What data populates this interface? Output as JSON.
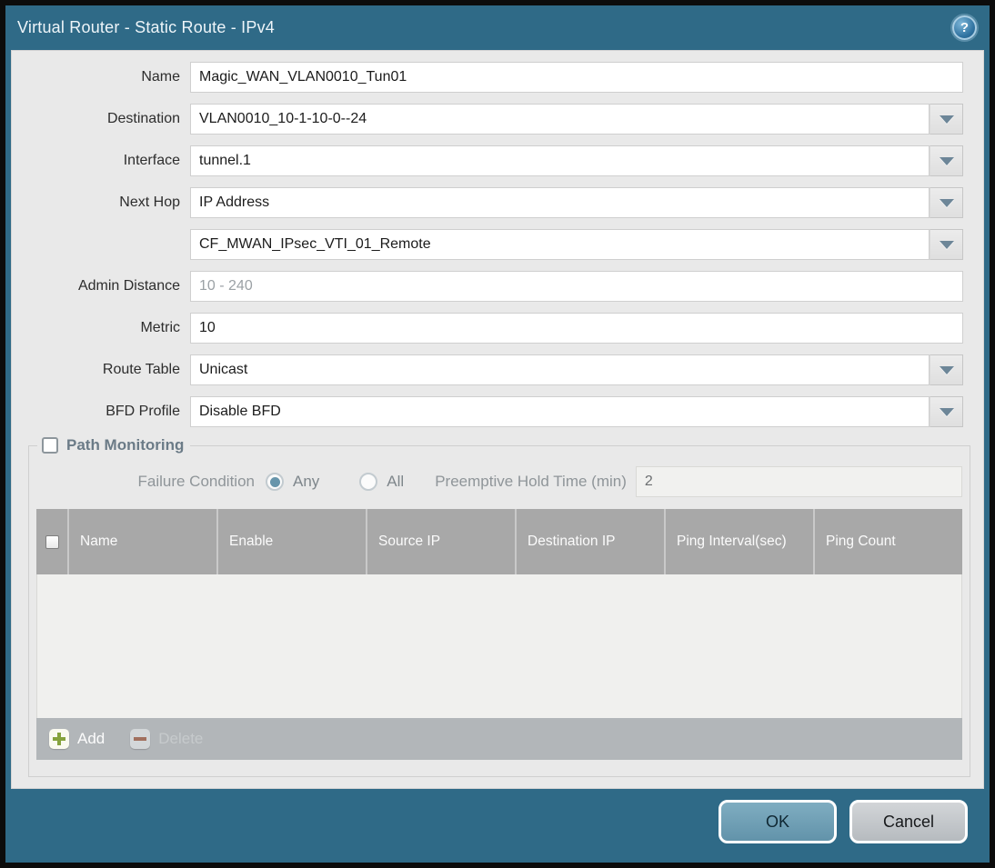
{
  "titlebar": {
    "title": "Virtual Router - Static Route - IPv4",
    "help_glyph": "?"
  },
  "form": {
    "fields": [
      {
        "label": "Name",
        "value": "Magic_WAN_VLAN0010_Tun01"
      },
      {
        "label": "Destination",
        "value": "VLAN0010_10-1-10-0--24"
      },
      {
        "label": "Interface",
        "value": "tunnel.1"
      },
      {
        "label": "Next Hop",
        "value": "IP Address"
      },
      {
        "label": "",
        "value": "CF_MWAN_IPsec_VTI_01_Remote"
      },
      {
        "label": "Admin Distance",
        "value": "",
        "placeholder": "10 - 240"
      },
      {
        "label": "Metric",
        "value": "10"
      },
      {
        "label": "Route Table",
        "value": "Unicast"
      },
      {
        "label": "BFD Profile",
        "value": "Disable BFD"
      }
    ]
  },
  "path_monitoring": {
    "title": "Path Monitoring",
    "enabled": false,
    "failure_condition_label": "Failure Condition",
    "radio_any_label": "Any",
    "radio_all_label": "All",
    "selected_failure_condition": "Any",
    "preemptive_label": "Preemptive Hold Time (min)",
    "preemptive_value": "2",
    "table": {
      "columns": [
        "Name",
        "Enable",
        "Source IP",
        "Destination IP",
        "Ping Interval(sec)",
        "Ping Count"
      ],
      "rows": []
    },
    "add_label": "Add",
    "delete_label": "Delete"
  },
  "footer": {
    "ok_label": "OK",
    "cancel_label": "Cancel"
  },
  "colors": {
    "titlebar_teal": "#2f6a87",
    "content_bg": "#e9e9e9",
    "table_header_gray": "#a8a8a8",
    "ok_button": "#6fa1b7",
    "cancel_button": "#c5c9cc",
    "add_plus_green": "#85a23d",
    "delete_minus_red": "#a1705e",
    "dropdown_arrow": "#6d8698"
  }
}
